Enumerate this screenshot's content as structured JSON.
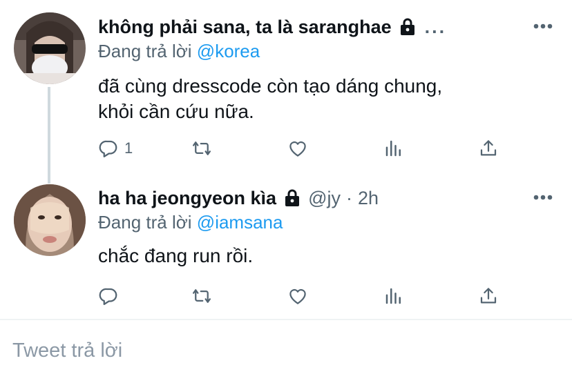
{
  "tweets": [
    {
      "display_name": "không phải sana, ta là saranghae",
      "truncated": "...",
      "replying_label": "Đang trả lời",
      "replying_to": "@korea",
      "text": [
        "đã cùng dresscode còn tạo dáng chung,",
        "khỏi cần cứu nữa."
      ],
      "reply_count": "1",
      "locked": true
    },
    {
      "display_name": "ha ha jeongyeon kìa",
      "handle": "@jy",
      "separator": "·",
      "time": "2h",
      "replying_label": "Đang trả lời",
      "replying_to": "@iamsana",
      "text": [
        "chắc đang run rồi."
      ],
      "reply_count": "",
      "locked": true
    }
  ],
  "compose": {
    "placeholder": "Tweet trả lời"
  },
  "icons": {
    "reply": "reply-icon",
    "retweet": "retweet-icon",
    "like": "heart-icon",
    "analytics": "analytics-icon",
    "share": "share-icon",
    "more": "more-icon",
    "lock": "lock-icon"
  },
  "colors": {
    "link": "#1d9bf0",
    "secondary": "#536471",
    "placeholder": "#8b98a5"
  }
}
